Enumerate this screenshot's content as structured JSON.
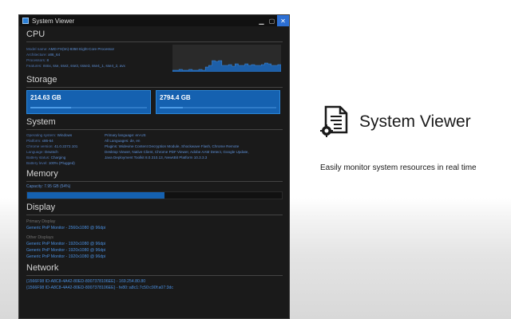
{
  "window": {
    "title": "System Viewer"
  },
  "cpu": {
    "heading": "CPU",
    "info": [
      {
        "k": "Model name:",
        "v": "AMD FX(tm)-8350 Eight-Core Processor"
      },
      {
        "k": "Architecture:",
        "v": "x86_64"
      },
      {
        "k": "Processors:",
        "v": "8"
      },
      {
        "k": "Features:",
        "v": "mmx, sse, sse2, sse3, ssse3, sse4_1, sse4_2, avx"
      }
    ],
    "usage_history": [
      2,
      2,
      3,
      2,
      2,
      3,
      2,
      2,
      3,
      2,
      6,
      8,
      14,
      13,
      14,
      8,
      8,
      9,
      7,
      10,
      8,
      8,
      10,
      8,
      9,
      8,
      8,
      9,
      11,
      10,
      8,
      8,
      9,
      8
    ]
  },
  "storage": {
    "heading": "Storage",
    "drives": [
      {
        "size": "214.63 GB",
        "used_fraction": 0.35
      },
      {
        "size": "2794.4 GB",
        "used_fraction": 0.2
      }
    ]
  },
  "system": {
    "heading": "System",
    "left": [
      {
        "k": "Operating system:",
        "v": "Windows"
      },
      {
        "k": "Platform:",
        "v": "x86-64"
      },
      {
        "k": "Chrome version:",
        "v": "41.0.2272.101"
      },
      {
        "k": "Language:",
        "v": "Deutsch"
      },
      {
        "k": "Battery status:",
        "v": "Charging"
      },
      {
        "k": "Battery level:",
        "v": "100% (Plugged)"
      }
    ],
    "right": [
      "Primary language: en-US",
      "All Languages: de, en",
      "Plugins: Widevine Content Decryption Module, Shockwave Flash, Chrome Remote",
      "Desktop Viewer, Native Client, Chrome PDF Viewer, Adobe AAM Detect, Google Update,",
      "Java Deployment Toolkit 8.0.310.13, NewsBit Platform 10.3.3.3"
    ]
  },
  "memory": {
    "heading": "Memory",
    "capacity_text": "Capacity: 7.95 GB (54%)",
    "used_fraction": 0.54
  },
  "display": {
    "heading": "Display",
    "primary_label": "Primary Display",
    "primary": "Generic PnP Monitor - 2560x1080 @ 96dpi",
    "other_label": "Other Displays",
    "others": [
      "Generic PnP Monitor - 1920x1080 @ 96dpi",
      "Generic PnP Monitor - 1920x1080 @ 96dpi",
      "Generic PnP Monitor - 1920x1080 @ 96dpi"
    ]
  },
  "network": {
    "heading": "Network",
    "items": [
      "{1566F98 ID-A8C8-4A42-80ED-8007378106EE} - 169.254.80.80",
      "{1566F98 ID-A8C8-4A42-80ED-8007378106EE} - fe80::a8c1:7c50:c90f:a07:3dc"
    ]
  },
  "brand": {
    "name": "System Viewer",
    "tagline": "Easily monitor system resources in real time",
    "icon": "document-gear-icon"
  },
  "colors": {
    "accent": "#1561b0",
    "window_bg": "#1a1a1a",
    "link": "#4a90e2",
    "close_button": "#2c6fd4"
  }
}
